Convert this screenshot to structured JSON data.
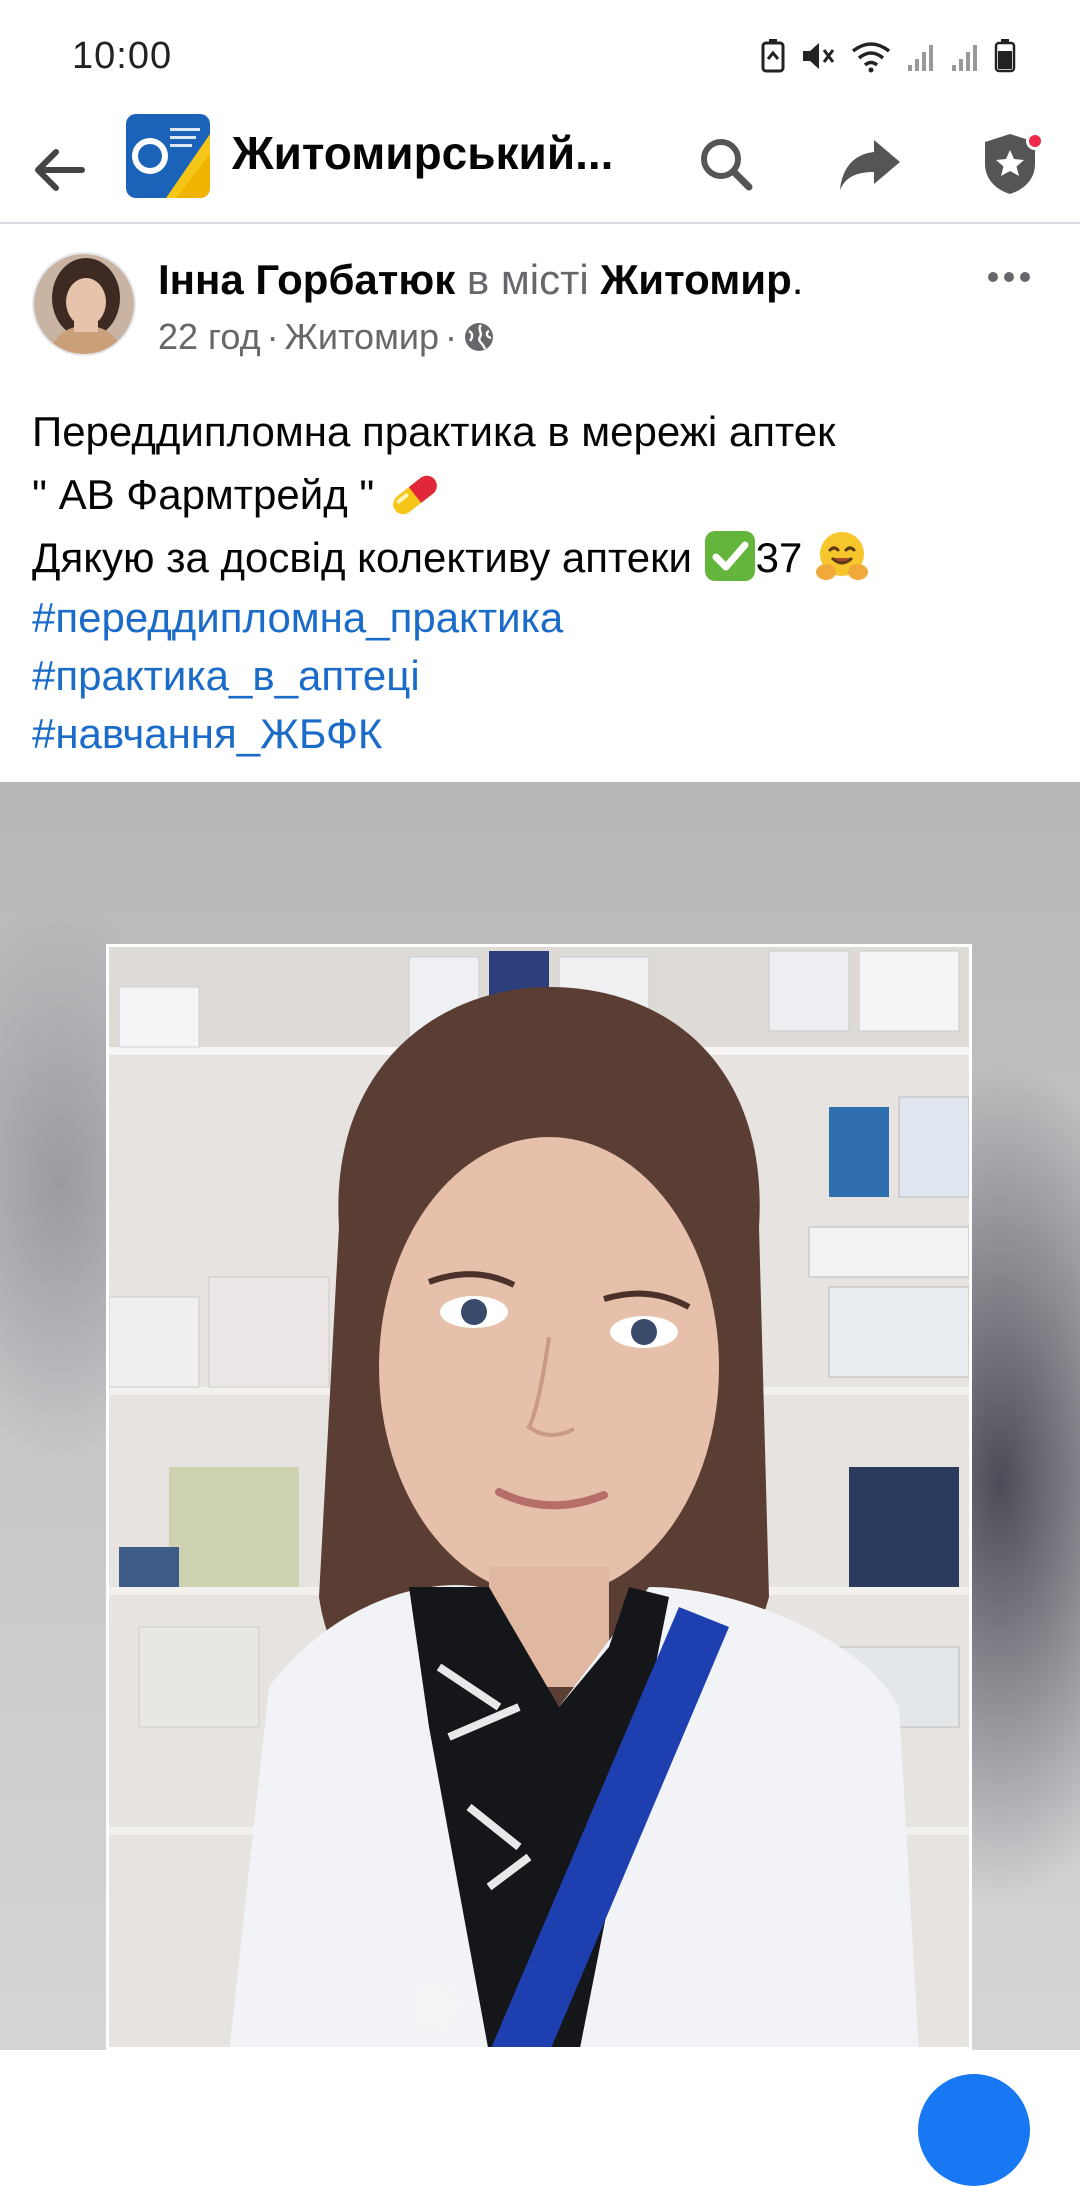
{
  "status_bar": {
    "time": "10:00"
  },
  "header": {
    "title": "Житомирський..."
  },
  "post": {
    "author": "Інна Горбатюк",
    "in_city_text": "в місті",
    "city": "Житомир",
    "city_period": ".",
    "time_ago": "22 год",
    "location": "Житомир",
    "separator": "·",
    "text_line1": "Переддипломна практика в мережі аптек",
    "text_line2": " \" АВ Фармтрейд \"",
    "text_line3_start": "Дякую за досвід колективу аптеки ",
    "text_line3_number": "37 ",
    "hashtags": [
      "#переддипломна_практика",
      "#практика_в_аптеці",
      "#навчання_ЖБФК"
    ]
  },
  "colors": {
    "hashtag": "#1b6bc8",
    "muted": "#65676b",
    "accent": "#1877f2",
    "notification": "#f02849"
  },
  "icons": {
    "back": "arrow-left-icon",
    "search": "search-icon",
    "share": "share-arrow-icon",
    "shield": "shield-star-icon",
    "more": "more-dots-icon",
    "globe": "globe-icon",
    "pill": "pill-emoji",
    "check": "check-mark-emoji",
    "hug": "hugging-face-emoji"
  }
}
